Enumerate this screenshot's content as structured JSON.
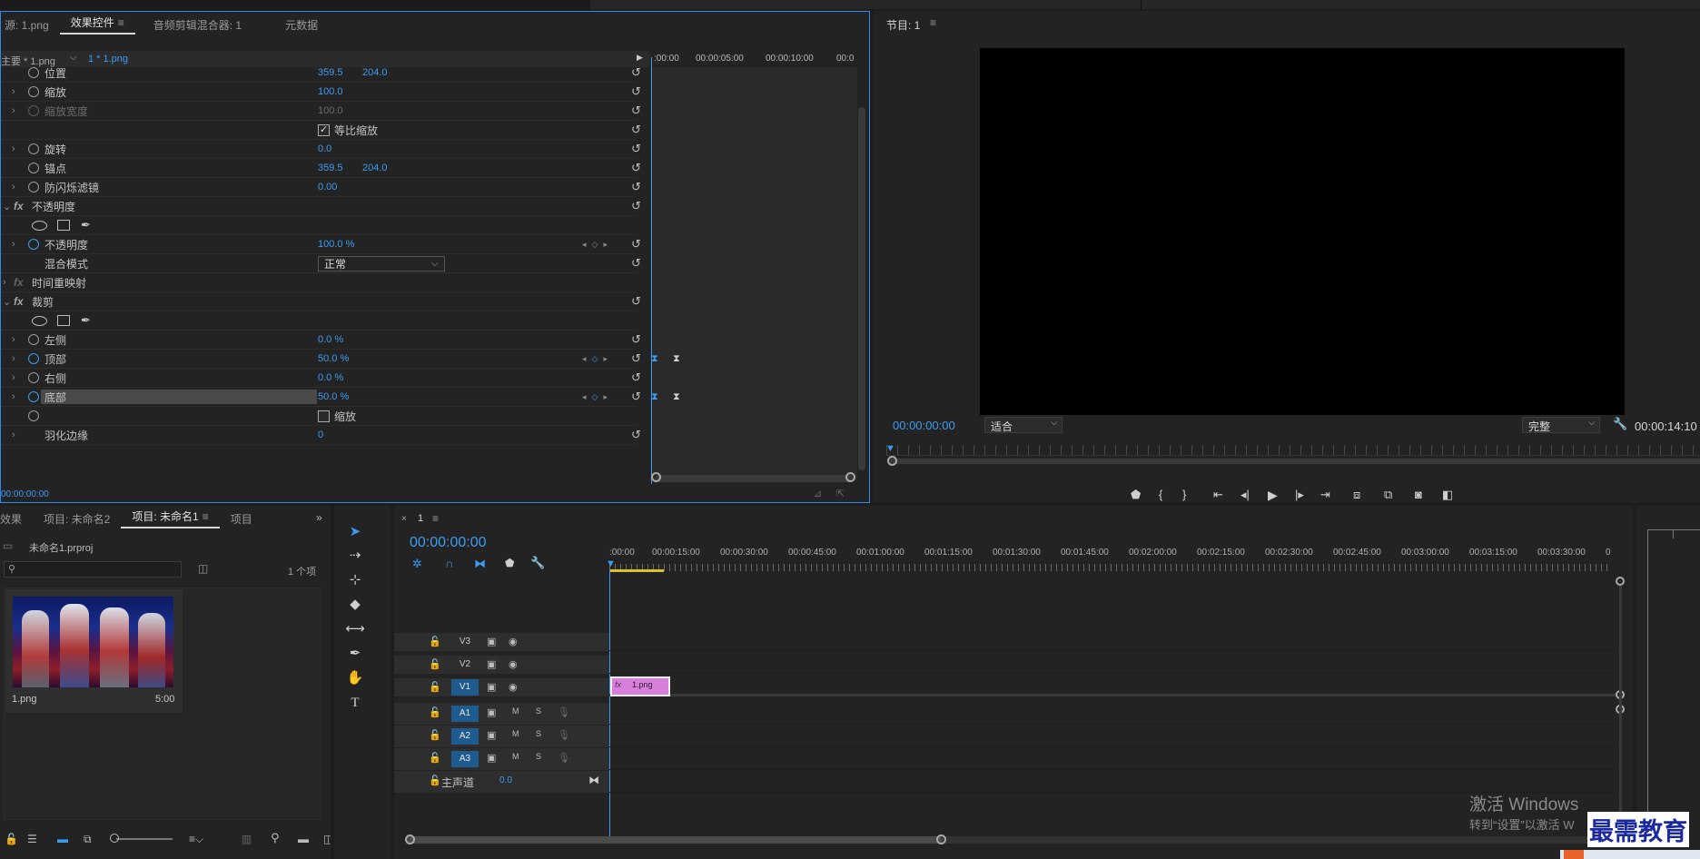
{
  "effect_controls": {
    "tabs": [
      "源: 1.png",
      "效果控件",
      "音频剪辑混合器: 1",
      "元数据"
    ],
    "active_tab": "效果控件",
    "clip_master": "主要 * 1.png",
    "clip_seq": "1 * 1.png",
    "timecodes": [
      ":00:00",
      "00:00:05:00",
      "00:00:10:00",
      "00:0"
    ],
    "rows": [
      {
        "label": "位置",
        "v1": "359.5",
        "v2": "204.0"
      },
      {
        "label": "缩放",
        "v1": "100.0"
      },
      {
        "label": "缩放宽度",
        "v1": "100.0"
      },
      {
        "check": "等比缩放"
      },
      {
        "label": "旋转",
        "v1": "0.0"
      },
      {
        "label": "锚点",
        "v1": "359.5",
        "v2": "204.0"
      },
      {
        "label": "防闪烁滤镜",
        "v1": "0.00"
      },
      {
        "section": "不透明度"
      },
      {
        "shapes": true
      },
      {
        "label": "不透明度",
        "v1": "100.0 %"
      },
      {
        "label": "混合模式",
        "select": "正常"
      },
      {
        "section": "时间重映射"
      },
      {
        "section": "裁剪"
      },
      {
        "shapes": true
      },
      {
        "label": "左侧",
        "v1": "0.0 %"
      },
      {
        "label": "顶部",
        "v1": "50.0 %"
      },
      {
        "label": "右侧",
        "v1": "0.0 %"
      },
      {
        "label": "底部",
        "v1": "50.0 %"
      },
      {
        "check": "缩放"
      },
      {
        "label": "羽化边缘",
        "v1": "0"
      }
    ],
    "bottom_timecode": "00:00:00:00"
  },
  "program": {
    "title": "节目: 1",
    "timecode": "00:00:00:00",
    "fit": "适合",
    "quality": "完整",
    "duration": "00:00:14:10"
  },
  "project": {
    "tabs": [
      "效果",
      "项目: 未命名2",
      "项目: 未命名1",
      "项目"
    ],
    "active_tab": "项目: 未命名1",
    "file": "未命名1.prproj",
    "count": "1 个项",
    "item_name": "1.png",
    "item_duration": "5:00"
  },
  "timeline": {
    "tab": "1",
    "timecode": "00:00:00:00",
    "ruler": [
      ":00:00",
      "00:00:15:00",
      "00:00:30:00",
      "00:00:45:00",
      "00:01:00:00",
      "00:01:15:00",
      "00:01:30:00",
      "00:01:45:00",
      "00:02:00:00",
      "00:02:15:00",
      "00:02:30:00",
      "00:02:45:00",
      "00:03:00:00",
      "00:03:15:00",
      "00:03:30:00",
      "0"
    ],
    "tracks": [
      "V3",
      "V2",
      "V1",
      "A1",
      "A2",
      "A3"
    ],
    "master": "主声道",
    "master_value": "0.0",
    "clip": "1.png"
  },
  "watermark": {
    "line1": "激活 Windows",
    "line2": "转到“设置”以激活 W",
    "brand": "最需教育"
  },
  "colors": {
    "accent": "#3d9cf0",
    "clip": "#d77fdb",
    "track_on": "#1e5b8f"
  }
}
